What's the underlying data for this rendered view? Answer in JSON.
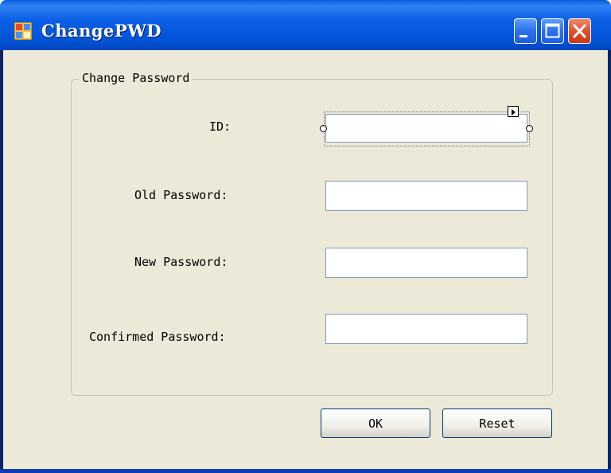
{
  "window": {
    "title": "ChangePWD",
    "controls": [
      "minimize-icon",
      "maximize-icon",
      "close-icon"
    ]
  },
  "group": {
    "title": "Change Password"
  },
  "fields": {
    "id_label": "ID:",
    "id_value": "",
    "old_password_label": "Old Password:",
    "old_password_value": "",
    "new_password_label": "New Password:",
    "new_password_value": "",
    "confirm_password_label": "Confirmed Password:",
    "confirm_password_value": ""
  },
  "buttons": {
    "ok": "OK",
    "reset": "Reset"
  },
  "colors": {
    "titlebar": "#0353d6",
    "close_button": "#e0522c",
    "client_background": "#ece9d8",
    "input_border": "#7f9db9"
  }
}
